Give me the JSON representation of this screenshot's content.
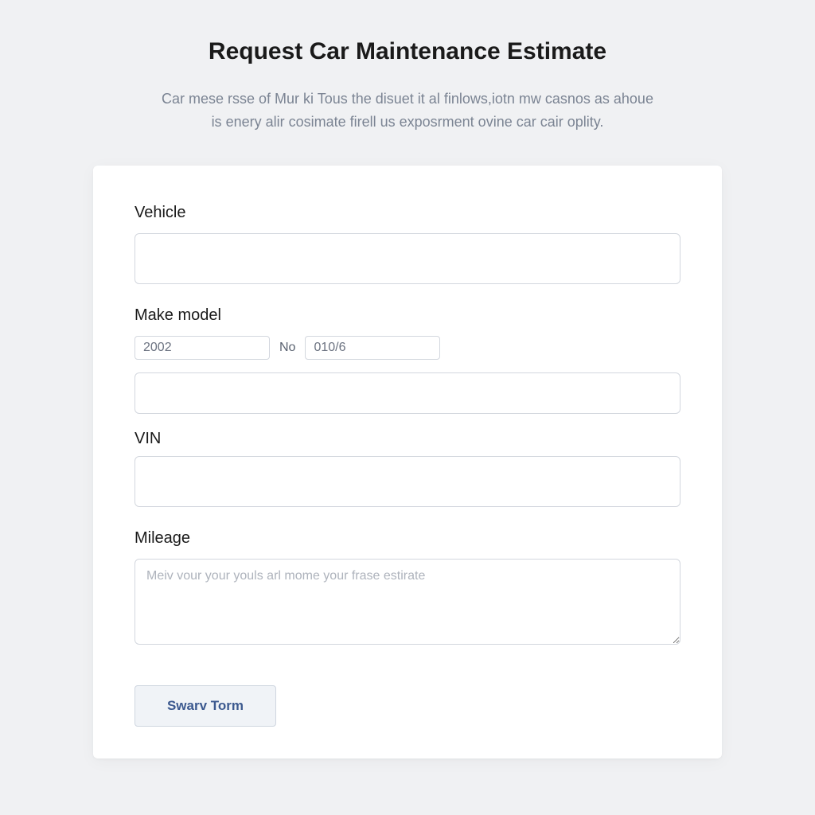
{
  "header": {
    "title": "Request Car Maintenance Estimate",
    "subtitle": "Car mese rsse of Mur ki Tous the disuet it al finlows,iotn mw casnos as ahoue is enery alir cosimate firell us exposrment ovine car cair oplity."
  },
  "form": {
    "vehicle": {
      "label": "Vehicle",
      "value": ""
    },
    "make_model": {
      "label": "Make model",
      "year_value": "2002",
      "between_label": "No",
      "code_value": "010/6",
      "full_value": ""
    },
    "vin": {
      "label": "VIN",
      "value": ""
    },
    "mileage": {
      "label": "Mileage",
      "placeholder": "Meiv vour your youls arl mome your frase estirate",
      "value": ""
    },
    "submit": {
      "label": "Swarv Torm"
    }
  }
}
